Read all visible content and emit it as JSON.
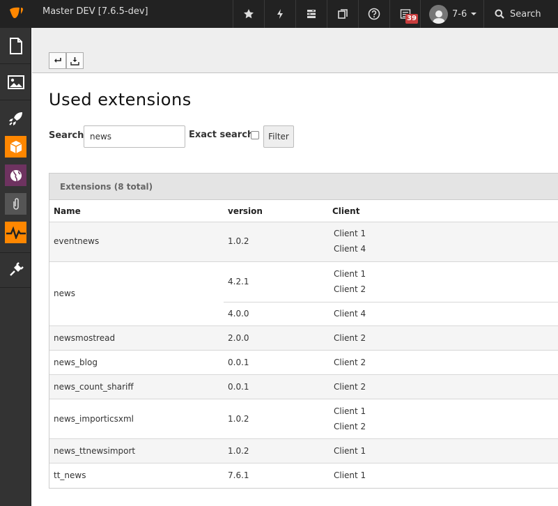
{
  "topbar": {
    "site_name": "Master DEV [7.6.5-dev]",
    "notification_count": "39",
    "username": "7-6",
    "search_label": "Search",
    "icons": [
      "typo3-logo-icon",
      "star-icon",
      "bolt-icon",
      "database-icon",
      "copy-icon",
      "help-icon",
      "tasks-icon",
      "user-icon",
      "search-icon"
    ]
  },
  "sidebar": {
    "modules": [
      "page-icon",
      "image-icon",
      "rocket-icon",
      "box-icon",
      "globe-icon",
      "paperclip-icon",
      "pulse-icon",
      "plug-icon"
    ],
    "accent_orange": "#ff8700",
    "accent_purple": "#6e3360"
  },
  "docheader": {
    "buttons": [
      "return-icon",
      "download-icon"
    ]
  },
  "main": {
    "title": "Used extensions",
    "search_label": "Search",
    "search_value": "news",
    "exact_label": "Exact search",
    "filter_label": "Filter"
  },
  "table": {
    "caption": "Extensions (8 total)",
    "headers": {
      "name": "Name",
      "version": "version",
      "client": "Client"
    },
    "rows": [
      {
        "name": "eventnews",
        "versions": [
          {
            "version": "1.0.2",
            "clients": [
              "Client 1",
              "Client 4"
            ]
          }
        ]
      },
      {
        "name": "news",
        "versions": [
          {
            "version": "4.2.1",
            "clients": [
              "Client 1",
              "Client 2"
            ]
          },
          {
            "version": "4.0.0",
            "clients": [
              "Client 4"
            ]
          }
        ]
      },
      {
        "name": "newsmostread",
        "versions": [
          {
            "version": "2.0.0",
            "clients": [
              "Client 2"
            ]
          }
        ]
      },
      {
        "name": "news_blog",
        "versions": [
          {
            "version": "0.0.1",
            "clients": [
              "Client 2"
            ]
          }
        ]
      },
      {
        "name": "news_count_shariff",
        "versions": [
          {
            "version": "0.0.1",
            "clients": [
              "Client 2"
            ]
          }
        ]
      },
      {
        "name": "news_importicsxml",
        "versions": [
          {
            "version": "1.0.2",
            "clients": [
              "Client 1",
              "Client 2"
            ]
          }
        ]
      },
      {
        "name": "news_ttnewsimport",
        "versions": [
          {
            "version": "1.0.2",
            "clients": [
              "Client 1"
            ]
          }
        ]
      },
      {
        "name": "tt_news",
        "versions": [
          {
            "version": "7.6.1",
            "clients": [
              "Client 1"
            ]
          }
        ]
      }
    ]
  }
}
